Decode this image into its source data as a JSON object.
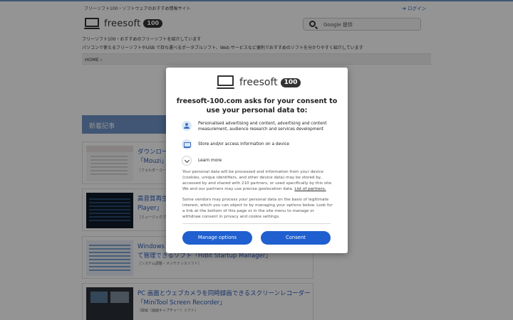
{
  "site": {
    "tagline": "フリーソフト100・ソフトウェアのおすすめ情報サイト",
    "login_icon": "login-icon",
    "login_label": "ログイン",
    "logo_word": "freesoft",
    "logo_badge": "100",
    "search_label": "Google 提供",
    "desc_line1": "フリーソフト100・おすすめのフリーソフトを紹介しています",
    "desc_line2": "パソコンで使えるフリーソフトやUSB で持ち運べるポータブルソフト、Web サービスなど便利でおすすめのソフトを分かりやすく紹介しています",
    "breadcrumb": "HOME ›",
    "section_title": "新着記事",
    "accent_color": "#6f95c8"
  },
  "articles": [
    {
      "title": "ダウンロー…「Mouzi」",
      "title_l1": "ダウンロー",
      "title_l2": "「Mouzi」",
      "category": "［フォルダーユーティリティ］"
    },
    {
      "title": "高音質再生…Player",
      "title_l1": "高音質再生",
      "title_l2": "Player」",
      "category": "［ミュージックプレイヤー］"
    },
    {
      "title": "Windows … て管理できるソフト「HiBit Startup Manager」",
      "title_l1": "Windows ",
      "title_l2": "て管理できるソフト「HiBit Startup Manager」",
      "category": "［システム調整・メンテナンスソフト］"
    },
    {
      "title": "PC 画面とウェブカメラを同時録画できるスクリーンレコーダー「MiniTool Screen Recorder」",
      "title_l1": "PC 画面とウェブカメラを同時録画できるスクリーンレコーダー",
      "title_l2": "「MiniTool Screen Recorder」",
      "category": "［録画（画面キャプチャー）ソフト］"
    }
  ],
  "consent": {
    "logo_word": "freesoft",
    "logo_badge": "100",
    "title": "freesoft-100.com asks for your consent to use your personal data to:",
    "purposes": [
      {
        "icon": "person-icon",
        "text": "Personalised advertising and content, advertising and content measurement, audience research and services development"
      },
      {
        "icon": "device-icon",
        "text": "Store and/or access information on a device"
      }
    ],
    "learn_more": "Learn more",
    "paragraph1": "Your personal data will be processed and information from your device (cookies, unique identifiers, and other device data) may be stored by, accessed by and shared with 210 partners, or used specifically by this site. We and our partners may use precise geolocation data.",
    "partners_link": "List of partners.",
    "paragraph2": "Some vendors may process your personal data on the basis of legitimate interest, which you can object to by managing your options below. Look for a link at the bottom of this page or in the site menu to manage or withdraw consent in privacy and cookie settings.",
    "manage_button": "Manage options",
    "consent_button": "Consent",
    "button_color": "#1f5fcf"
  }
}
